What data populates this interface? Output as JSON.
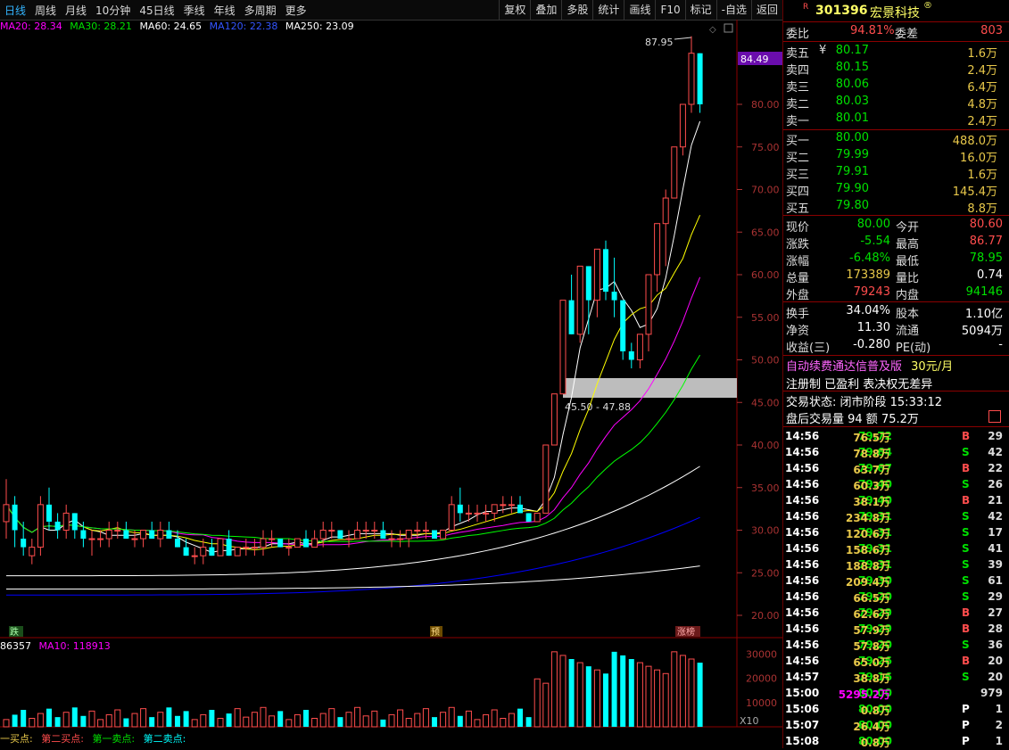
{
  "toolbar": {
    "periods": [
      "日线",
      "周线",
      "月线",
      "10分钟",
      "45日线",
      "季线",
      "年线",
      "多周期",
      "更多"
    ],
    "actions": [
      "复权",
      "叠加",
      "多股",
      "统计",
      "画线",
      "F10",
      "标记",
      "-自选",
      "返回"
    ]
  },
  "ma_legend": {
    "ma20": "MA20: 28.34",
    "ma30": "MA30: 28.21",
    "ma60": "MA60: 24.65",
    "ma120": "MA120: 22.38",
    "ma250": "MA250: 23.09"
  },
  "chart_labels": {
    "peak": "87.95",
    "current_price_tag": "84.49",
    "zone_range": "45.50 - 47.88",
    "markers": [
      "跌",
      "预",
      "涨榜"
    ],
    "y_ticks": [
      "80.00",
      "75.00",
      "70.00",
      "65.00",
      "60.00",
      "55.00",
      "50.00",
      "45.00",
      "40.00",
      "35.00",
      "30.00",
      "25.00",
      "20.00"
    ],
    "vol_ticks": [
      "30000",
      "20000",
      "10000"
    ],
    "vol_unit": "X10"
  },
  "vol_legend": {
    "ma5": "86357",
    "ma10": "MA10: 118913"
  },
  "bs_legend": [
    "一买点:",
    "第二买点:",
    "第一卖点:",
    "第二卖点:"
  ],
  "colors": {
    "up": "#ff4d4d",
    "down": "#00ffff",
    "ma5": "#ffffff",
    "ma10": "#ffff00",
    "ma20": "#ff00ff",
    "ma30": "#00ff00",
    "ma60": "#ffffff",
    "ma120": "#0000ff",
    "ma250": "#ffffff",
    "bg": "#000000"
  },
  "stock": {
    "r_badge": "R",
    "code": "301396",
    "name": "宏景科技",
    "reg": "®"
  },
  "quote": {
    "ratio": {
      "label": "委比",
      "value": "94.81%",
      "label2": "委差",
      "value2": "803"
    },
    "asks": [
      {
        "label": "卖五",
        "price": "80.17",
        "vol": "1.6万",
        "extra": "¥"
      },
      {
        "label": "卖四",
        "price": "80.15",
        "vol": "2.4万"
      },
      {
        "label": "卖三",
        "price": "80.06",
        "vol": "6.4万"
      },
      {
        "label": "卖二",
        "price": "80.03",
        "vol": "4.8万"
      },
      {
        "label": "卖一",
        "price": "80.01",
        "vol": "2.4万"
      }
    ],
    "bids": [
      {
        "label": "买一",
        "price": "80.00",
        "vol": "488.0万"
      },
      {
        "label": "买二",
        "price": "79.99",
        "vol": "16.0万"
      },
      {
        "label": "买三",
        "price": "79.91",
        "vol": "1.6万"
      },
      {
        "label": "买四",
        "price": "79.90",
        "vol": "145.4万"
      },
      {
        "label": "买五",
        "price": "79.80",
        "vol": "8.8万"
      }
    ],
    "stats": [
      {
        "l1": "现价",
        "v1": "80.00",
        "l2": "今开",
        "v2": "80.60"
      },
      {
        "l1": "涨跌",
        "v1": "-5.54",
        "l2": "最高",
        "v2": "86.77"
      },
      {
        "l1": "涨幅",
        "v1": "-6.48%",
        "l2": "最低",
        "v2": "78.95"
      },
      {
        "l1": "总量",
        "v1": "173389",
        "l2": "量比",
        "v2": "0.74"
      },
      {
        "l1": "外盘",
        "v1": "79243",
        "l2": "内盘",
        "v2": "94146"
      }
    ],
    "stats2": [
      {
        "l1": "换手",
        "v1": "34.04%",
        "l2": "股本",
        "v2": "1.10亿"
      },
      {
        "l1": "净资",
        "v1": "11.30",
        "l2": "流通",
        "v2": "5094万"
      },
      {
        "l1": "收益(三)",
        "v1": "-0.280",
        "l2": "PE(动)",
        "v2": "-"
      }
    ],
    "ad": "自动续费通达信普及版",
    "ad_price": "30元/月",
    "reg_line": "注册制 已盈利 表决权无差异",
    "status": "交易状态: 闭市阶段 15:33:12",
    "after": "盘后交易量 94 额 75.2万"
  },
  "ticks": [
    {
      "t": "14:56",
      "p": "79.72",
      "v": "76.5万",
      "s": "B",
      "n": "29"
    },
    {
      "t": "14:56",
      "p": "79.64",
      "v": "78.8万",
      "s": "S",
      "n": "42"
    },
    {
      "t": "14:56",
      "p": "79.67",
      "v": "63.7万",
      "s": "B",
      "n": "22"
    },
    {
      "t": "14:56",
      "p": "79.40",
      "v": "60.3万",
      "s": "S",
      "n": "26"
    },
    {
      "t": "14:56",
      "p": "79.40",
      "v": "38.1万",
      "s": "B",
      "n": "21"
    },
    {
      "t": "14:56",
      "p": "79.31",
      "v": "234.8万",
      "s": "S",
      "n": "42"
    },
    {
      "t": "14:56",
      "p": "79.31",
      "v": "120.6万",
      "s": "S",
      "n": "17"
    },
    {
      "t": "14:56",
      "p": "79.31",
      "v": "158.6万",
      "s": "S",
      "n": "41"
    },
    {
      "t": "14:56",
      "p": "79.31",
      "v": "188.8万",
      "s": "S",
      "n": "39"
    },
    {
      "t": "14:56",
      "p": "79.30",
      "v": "209.4万",
      "s": "S",
      "n": "61"
    },
    {
      "t": "14:56",
      "p": "79.20",
      "v": "66.5万",
      "s": "S",
      "n": "29"
    },
    {
      "t": "14:56",
      "p": "79.29",
      "v": "62.6万",
      "s": "B",
      "n": "27"
    },
    {
      "t": "14:56",
      "p": "79.29",
      "v": "57.9万",
      "s": "B",
      "n": "28"
    },
    {
      "t": "14:56",
      "p": "79.20",
      "v": "57.8万",
      "s": "S",
      "n": "36"
    },
    {
      "t": "14:56",
      "p": "79.26",
      "v": "65.0万",
      "s": "B",
      "n": "20"
    },
    {
      "t": "14:57",
      "p": "79.16",
      "v": "38.8万",
      "s": "S",
      "n": "20"
    },
    {
      "t": "15:00",
      "p": "80.00",
      "v": "5295.2万",
      "s": "",
      "n": "979"
    },
    {
      "t": "15:06",
      "p": "80.00",
      "v": "0.8万",
      "s": "P",
      "n": "1"
    },
    {
      "t": "15:07",
      "p": "80.00",
      "v": "26.4万",
      "s": "P",
      "n": "2"
    },
    {
      "t": "15:08",
      "p": "80.00",
      "v": "0.8万",
      "s": "P",
      "n": "1"
    }
  ]
}
